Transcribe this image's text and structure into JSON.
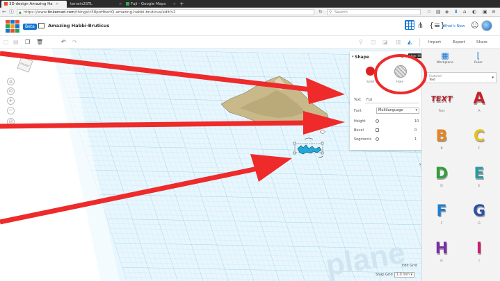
{
  "browser": {
    "tabs": [
      {
        "title": "3D design Amazing Ha",
        "active": true
      },
      {
        "title": "terrain2STL",
        "active": false
      },
      {
        "title": "Fuji - Google Maps",
        "active": false
      }
    ],
    "url_prefix": "https://www.",
    "url_host": "tinkercad.com",
    "url_path": "/things/c58poHberIQ-amazing-habbi-bruticus/edit/v2",
    "search_placeholder": "Search"
  },
  "app": {
    "logo_letters": [
      "TIN",
      "KER",
      "CAD"
    ],
    "beta": "Beta",
    "design_name": "Amazing Habbi-Bruticus",
    "whats_new": "What's New",
    "toolbar": {
      "import": "Import",
      "export": "Export",
      "share": "Share"
    }
  },
  "inspector": {
    "title": "Shape",
    "solid_label": "Solid",
    "hole_label": "Hole",
    "tooltip": "Hole (H)",
    "text_label": "Text",
    "text_value": "Fuji",
    "font_label": "Font",
    "font_value": "Multilanguage",
    "height_label": "Height",
    "height_value": "10",
    "bevel_label": "Bevel",
    "bevel_value": "0",
    "segments_label": "Segments",
    "segments_value": "1"
  },
  "workplane": {
    "edit_grid": "Edit Grid",
    "snap_grid_label": "Snap Grid",
    "snap_grid_value": "1.0 mm",
    "watermark": "plane"
  },
  "right_panel": {
    "workplane_label": "Workplane",
    "ruler_label": "Ruler",
    "library_caption": "Featured",
    "library_value": "Text",
    "shapes": [
      {
        "glyph": "TEXT",
        "label": "Text",
        "color": "#c0202e"
      },
      {
        "glyph": "A",
        "label": "A",
        "color": "#c8202a"
      },
      {
        "glyph": "B",
        "label": "B",
        "color": "#e8841f"
      },
      {
        "glyph": "C",
        "label": "C",
        "color": "#e6c21a"
      },
      {
        "glyph": "D",
        "label": "D",
        "color": "#2f9e3b"
      },
      {
        "glyph": "E",
        "label": "E",
        "color": "#2a9aa0"
      },
      {
        "glyph": "F",
        "label": "F",
        "color": "#1d7fcf"
      },
      {
        "glyph": "G",
        "label": "G",
        "color": "#2d4fa8"
      },
      {
        "glyph": "H",
        "label": "H",
        "color": "#7a2fa8"
      },
      {
        "glyph": "I",
        "label": "I",
        "color": "#c8206f"
      }
    ]
  },
  "colors": {
    "accent": "#1477d1",
    "annotation_red": "#ee2a2a",
    "grid_blue": "#bfe3f4",
    "mountain": "#c9b98a"
  }
}
